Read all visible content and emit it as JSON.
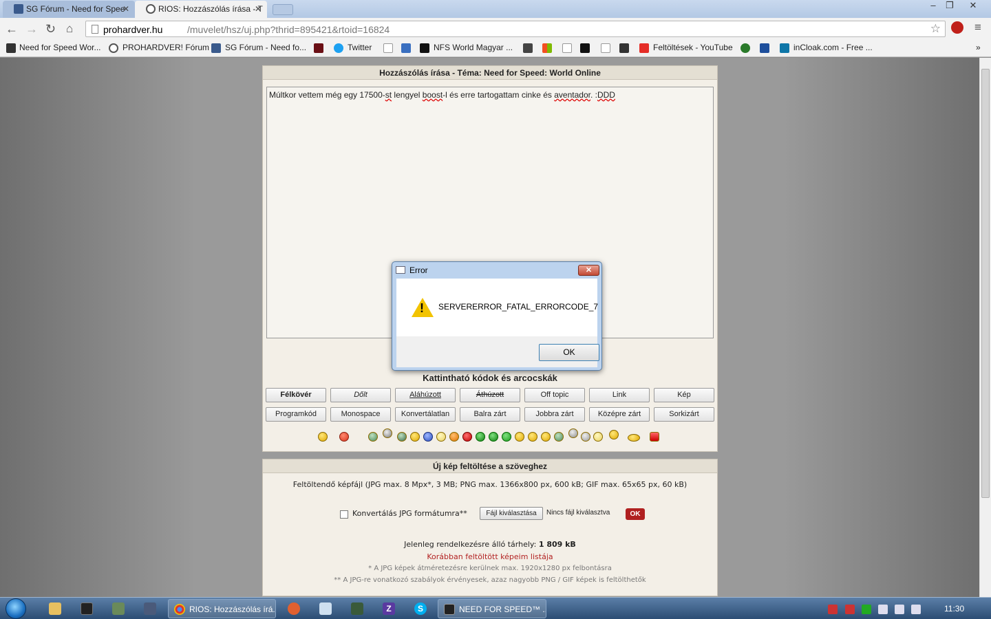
{
  "browser": {
    "tabs": [
      {
        "label": "SG Fórum - Need for Spee",
        "active": false
      },
      {
        "label": "RIOS: Hozzászólás írása - T",
        "active": true
      }
    ],
    "url": {
      "host": "prohardver.hu",
      "path": "/muvelet/hsz/uj.php?thrid=895421&rtoid=16824"
    },
    "bookmarks": [
      {
        "label": "Need for Speed Wor..."
      },
      {
        "label": "PROHARDVER! Fórum"
      },
      {
        "label": "SG Fórum - Need fo..."
      },
      {
        "label": "Twitter"
      },
      {
        "label": "NFS World Magyar ..."
      },
      {
        "label": "Feltöltések - YouTube"
      },
      {
        "label": "inCloak.com - Free ..."
      }
    ]
  },
  "compose": {
    "title": "Hozzászólás írása - Téma: Need for Speed: World Online",
    "text_parts": [
      "Múltkor vettem még egy 17500-",
      "st",
      " lengyel ",
      "boost",
      "-l és erre tartogattam cinke és ",
      "aventador",
      ". :",
      "DDD"
    ],
    "codes_title": "Kattintható kódok és arcocskák",
    "buttons_row1": [
      "Félkövér",
      "Dőlt",
      "Aláhúzott",
      "Áthúzott",
      "Off topic",
      "Link",
      "Kép"
    ],
    "buttons_row2": [
      "Programkód",
      "Monospace",
      "Konvertálatlan",
      "Balra zárt",
      "Jobbra zárt",
      "Középre zárt",
      "Sorkizárt"
    ]
  },
  "upload": {
    "title": "Új kép feltöltése a szöveghez",
    "file_info": "Feltöltendő képfájl (JPG max. 8 Mpx*, 3 MB; PNG max. 1366x800 px, 600 kB; GIF max. 65x65 px, 60 kB)",
    "convert_label": "Konvertálás JPG formátumra**",
    "file_button": "Fájl kiválasztása",
    "no_file": "Nincs fájl kiválasztva",
    "ok_button": "OK",
    "space_label": "Jelenleg rendelkezésre álló tárhely:",
    "space_value": "1 809 kB",
    "list_link": "Korábban feltöltött képeim listája",
    "note1": "* A JPG képek átméretezésre kerülnek max. 1920x1280 px felbontásra",
    "note2": "** A JPG-re vonatkozó szabályok érvényesek, azaz nagyobb PNG / GIF képek is feltölthetők"
  },
  "dialog": {
    "title": "Error",
    "message": "SERVERERROR_FATAL_ERRORCODE_7",
    "ok": "OK",
    "close": "✕"
  },
  "taskbar": {
    "tasks": [
      {
        "label": "RIOS: Hozzászólás írá..."
      },
      {
        "label": "NEED FOR SPEED™ ..."
      }
    ],
    "clock": "11:30"
  },
  "colors": {
    "accent_red": "#b02020",
    "link_red": "#b22222",
    "panel_bg": "#f3efe7"
  }
}
